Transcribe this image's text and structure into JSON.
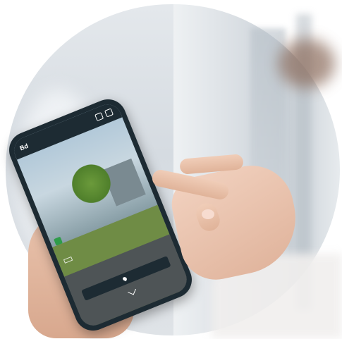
{
  "screen": {
    "logo": "Bd",
    "brand_line1": "",
    "brand_line2": "",
    "title": "",
    "label": "",
    "cta_label": ""
  },
  "colors": {
    "phone_frame": "#1d2b33",
    "pin_green": "#2f9c4a",
    "skin": "#e9c3ad"
  },
  "icons": [
    "menu-icon",
    "pin-icon",
    "chevron-down-icon"
  ]
}
